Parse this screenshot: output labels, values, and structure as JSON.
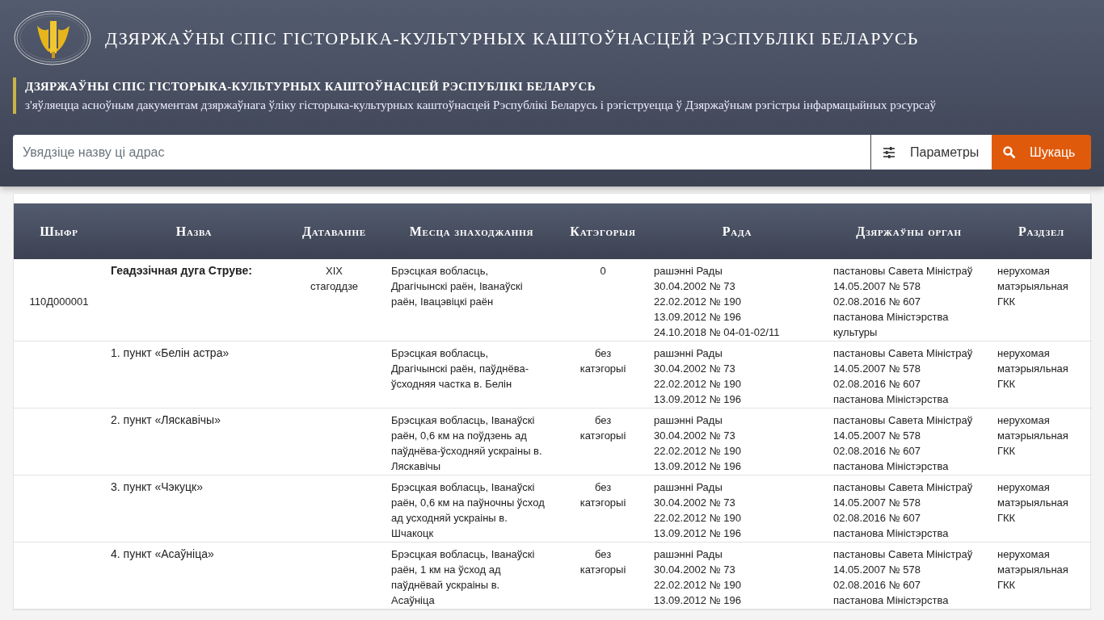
{
  "header": {
    "title": "ДЗЯРЖАЎНЫ СПІС ГІСТОРЫКА-КУЛЬТУРНЫХ КАШТОЎНАСЦЕЙ РЭСПУБЛІКІ БЕЛАРУСЬ",
    "notice": {
      "heading": "ДЗЯРЖАЎНЫ СПІС ГІСТОРЫКА-КУЛЬТУРНЫХ КАШТОЎНАСЦЕЙ РЭСПУБЛІКІ БЕЛАРУСЬ",
      "text": "з'яўляецца асноўным дакументам дзяржаўнага ўліку гісторыка-культурных каштоўнасцей Рэспублікі Беларусь і рэгіструецца ў Дзяржаўным рэгістры інфармацыйных рэсурсаў"
    }
  },
  "search": {
    "placeholder": "Увядзіце назву ці адрас",
    "params_button": "Параметры",
    "search_button": "Шукаць"
  },
  "table": {
    "columns": [
      "Шыфр",
      "Назва",
      "Датаванне",
      "Месца знаходжання",
      "Катэгорыя",
      "Рада",
      "Дзяржаўны орган",
      "Раздзел"
    ],
    "rows": [
      {
        "kind": "object",
        "code": "110Д000001",
        "name": "Геадэзічная дуга Струве:",
        "date": [
          "XIX",
          "стагоддзе"
        ],
        "location": "Брэсцкая вобласць, Драгічынскі раён, Іванаўскі раён, Івацэвіцкі раён",
        "category": [
          "0"
        ],
        "council": [
          "рашэнні Рады",
          "30.04.2002 № 73",
          "22.02.2012 № 190",
          "13.09.2012 № 196",
          "24.10.2018 № 04-01-02/11"
        ],
        "authority": [
          "пастановы Савета Міністраў",
          "14.05.2007 № 578",
          "02.08.2016 № 607",
          "пастанова Міністэрства",
          "культуры"
        ],
        "section": [
          "нерухомая",
          "матэрыяльная",
          "ГКК"
        ]
      },
      {
        "kind": "part",
        "name": "1. пункт «Белін астра»",
        "date": [],
        "location": "Брэсцкая вобласць, Драгічынскі раён, паўднёва-ўсходняя частка в. Белін",
        "category": [
          "без",
          "катэгорыі"
        ],
        "council": [
          "рашэнні Рады",
          "30.04.2002 № 73",
          "22.02.2012 № 190",
          "13.09.2012 № 196"
        ],
        "authority": [
          "пастановы Савета Міністраў",
          "14.05.2007 № 578",
          "02.08.2016 № 607",
          "пастанова Міністэрства"
        ],
        "section": [
          "нерухомая",
          "матэрыяльная",
          "ГКК"
        ]
      },
      {
        "kind": "part",
        "name": "2. пункт «Ляскавічы»",
        "date": [],
        "location": "Брэсцкая вобласць, Іванаўскі раён, 0,6 км на поўдзень ад паўднёва-ўсходняй ускраіны в. Ляскавічы",
        "category": [
          "без",
          "катэгорыі"
        ],
        "council": [
          "рашэнні Рады",
          "30.04.2002 № 73",
          "22.02.2012 № 190",
          "13.09.2012 № 196"
        ],
        "authority": [
          "пастановы Савета Міністраў",
          "14.05.2007 № 578",
          "02.08.2016 № 607",
          "пастанова Міністэрства"
        ],
        "section": [
          "нерухомая",
          "матэрыяльная",
          "ГКК"
        ]
      },
      {
        "kind": "part",
        "name": "3. пункт «Чэкуцк»",
        "date": [],
        "location": "Брэсцкая вобласць, Іванаўскі раён, 0,6 км на паўночны ўсход ад усходняй ускраіны в. Шчакоцк",
        "category": [
          "без",
          "катэгорыі"
        ],
        "council": [
          "рашэнні Рады",
          "30.04.2002 № 73",
          "22.02.2012 № 190",
          "13.09.2012 № 196"
        ],
        "authority": [
          "пастановы Савета Міністраў",
          "14.05.2007 № 578",
          "02.08.2016 № 607",
          "пастанова Міністэрства"
        ],
        "section": [
          "нерухомая",
          "матэрыяльная",
          "ГКК"
        ]
      },
      {
        "kind": "part",
        "name": "4. пункт «Асаўніца»",
        "date": [],
        "location": "Брэсцкая вобласць, Іванаўскі раён, 1 км на ўсход ад паўднёвай ускраіны в. Асаўніца",
        "category": [
          "без",
          "катэгорыі"
        ],
        "council": [
          "рашэнні Рады",
          "30.04.2002 № 73",
          "22.02.2012 № 190",
          "13.09.2012 № 196"
        ],
        "authority": [
          "пастановы Савета Міністраў",
          "14.05.2007 № 578",
          "02.08.2016 № 607",
          "пастанова Міністэрства"
        ],
        "section": [
          "нерухомая",
          "матэрыяльная",
          "ГКК"
        ]
      }
    ]
  }
}
